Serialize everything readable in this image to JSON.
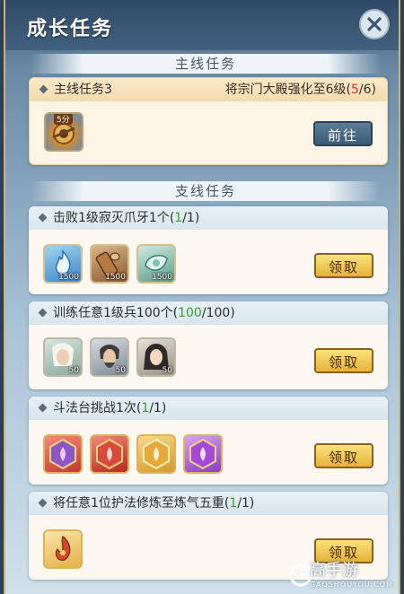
{
  "header": {
    "title": "成长任务",
    "close_icon": "close-icon"
  },
  "main_section": {
    "title": "主线任务",
    "task": {
      "name": "主线任务3",
      "desc_prefix": "将宗门大殿强化至6级(",
      "progress_current": "5",
      "progress_sep": "/6",
      "desc_suffix": ")",
      "reward": {
        "icon": "fan-shield-icon",
        "tag": "5分"
      },
      "button_label": "前往"
    }
  },
  "side_section": {
    "title": "支线任务",
    "tasks": [
      {
        "name": "击败1级寂灭爪牙1个",
        "progress_open": "(",
        "progress_current": "1",
        "progress_rest": "/1)",
        "rewards": [
          {
            "icon": "blue-flame-icon",
            "qty": "1500"
          },
          {
            "icon": "wood-log-icon",
            "qty": "1500"
          },
          {
            "icon": "jade-leaf-icon",
            "qty": "1500"
          }
        ],
        "button_label": "领取"
      },
      {
        "name": "训练任意1级兵100个",
        "progress_open": "(",
        "progress_current": "100",
        "progress_rest": "/100)",
        "rewards": [
          {
            "icon": "white-hair-warrior-portrait",
            "qty": "50"
          },
          {
            "icon": "bearded-warrior-portrait",
            "qty": "50"
          },
          {
            "icon": "female-warrior-portrait",
            "qty": "50"
          }
        ],
        "button_label": "领取"
      },
      {
        "name": "斗法台挑战1次",
        "progress_open": "(",
        "progress_current": "1",
        "progress_rest": "/1)",
        "rewards": [
          {
            "icon": "purple-lotus-badge-icon"
          },
          {
            "icon": "red-lotus-badge-icon"
          },
          {
            "icon": "gold-lotus-badge-icon"
          },
          {
            "icon": "violet-lotus-badge-icon"
          }
        ],
        "button_label": "领取"
      },
      {
        "name": "将任意1位护法修炼至炼气五重",
        "progress_open": "(",
        "progress_current": "1",
        "progress_rest": "/1)",
        "rewards": [
          {
            "icon": "flame-swirl-icon"
          }
        ],
        "button_label": "领取"
      }
    ]
  },
  "watermark": {
    "brand": "高手游",
    "url": "GAOSHOUYOU.COM"
  }
}
